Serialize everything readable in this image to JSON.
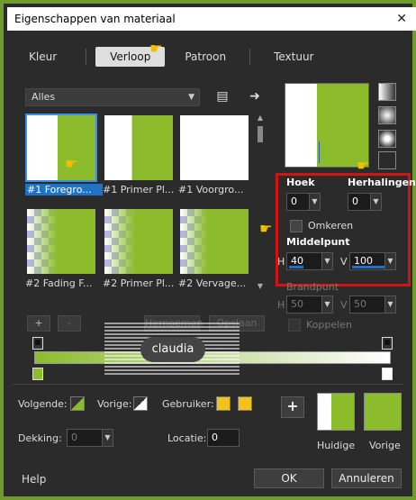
{
  "window": {
    "title": "Eigenschappen van materiaal",
    "close_glyph": "✕"
  },
  "tabs": [
    {
      "label": "Kleur",
      "active": false
    },
    {
      "label": "Verloop",
      "active": true
    },
    {
      "label": "Patroon",
      "active": false
    },
    {
      "label": "Textuur",
      "active": false
    }
  ],
  "category_dropdown": {
    "value": "Alles"
  },
  "gradients": [
    {
      "label": "#1 Foregro...",
      "selected": true
    },
    {
      "label": "#1 Primer Pl...",
      "selected": false
    },
    {
      "label": "#1 Voorgro...",
      "selected": false
    },
    {
      "label": "#2 Fading F...",
      "selected": false
    },
    {
      "label": "#2 Primer Pl...",
      "selected": false
    },
    {
      "label": "#2 Vervage...",
      "selected": false
    }
  ],
  "grid_buttons": {
    "add": "+",
    "remove": "-",
    "rename": "Hernoemen",
    "save": "Opslaan"
  },
  "settings": {
    "angle_label": "Hoek",
    "angle_value": "0",
    "repeats_label": "Herhalingen",
    "repeats_value": "0",
    "invert_label": "Omkeren",
    "center_label": "Middelpunt",
    "center_h_prefix": "H",
    "center_h": "40",
    "center_v_prefix": "V",
    "center_v": "100",
    "focal_label": "Brandpunt",
    "focal_h_prefix": "H",
    "focal_h": "50",
    "focal_v_prefix": "V",
    "focal_v": "50",
    "link_label": "Koppelen"
  },
  "stops": {
    "next_label": "Volgende:",
    "prev_label": "Vorige:",
    "user_label": "Gebruiker:",
    "opacity_label": "Dekking:",
    "opacity_value": "0",
    "location_label": "Locatie:",
    "location_value": "0",
    "add_button": "+"
  },
  "swatches": {
    "current_label": "Huidige",
    "previous_label": "Vorige",
    "green": "#8cbc2c",
    "yellow": "#f4c21c"
  },
  "footer": {
    "help": "Help",
    "ok": "OK",
    "cancel": "Annuleren"
  },
  "watermark": {
    "text": "claudia"
  }
}
